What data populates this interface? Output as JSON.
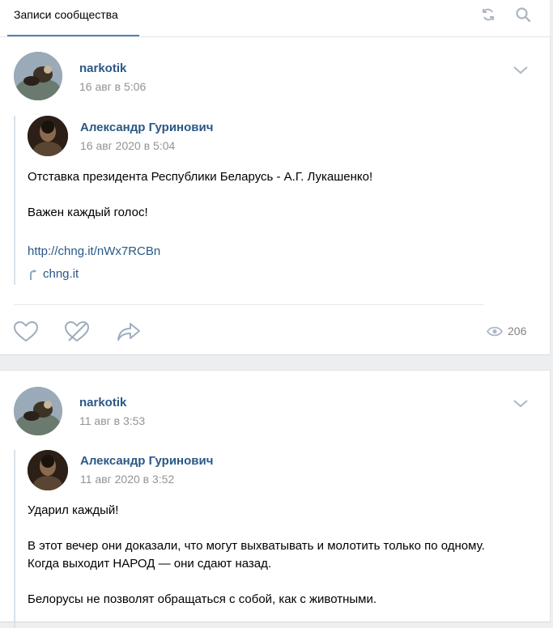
{
  "header": {
    "tab_label": "Записи сообщества"
  },
  "posts": [
    {
      "author": "narkotik",
      "date": "16 авг в 5:06",
      "repost": {
        "author": "Александр Гуринович",
        "date": "16 авг 2020 в 5:04",
        "text": "Отставка президента Республики Беларусь - А.Г. Лукашенко!\n\nВажен каждый голос!",
        "link": "http://chng.it/nWx7RCBn",
        "link_domain": "chng.it"
      },
      "views": "206"
    },
    {
      "author": "narkotik",
      "date": "11 авг в 3:53",
      "repost": {
        "author": "Александр Гуринович",
        "date": "11 авг 2020 в 3:52",
        "text": "Ударил каждый!\n\nВ этот вечер они доказали, что могут выхватывать и молотить только по одному.\nКогда выходит НАРОД — они сдают назад.\n\nБелорусы не позволят обращаться с собой, как с животными."
      }
    }
  ],
  "colors": {
    "link": "#2a5885",
    "accent": "#5181b8",
    "muted": "#939393",
    "background": "#edeef0"
  }
}
